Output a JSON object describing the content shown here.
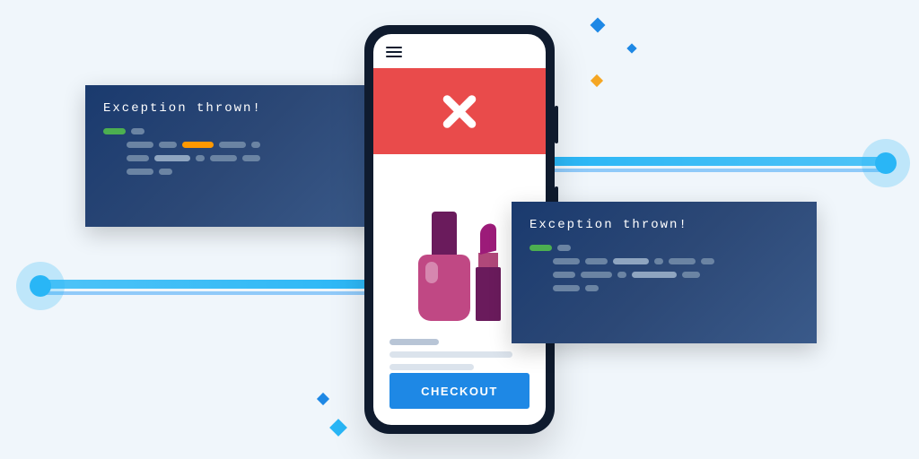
{
  "colors": {
    "background": "#f0f6fb",
    "panel_gradient_from": "#1a3a6e",
    "panel_gradient_to": "#3a5a8a",
    "error_red": "#e94b4b",
    "accent_blue": "#1e88e5",
    "accent_orange": "#f5a623",
    "signal_cyan": "#29b6f6"
  },
  "code_panels": {
    "left": {
      "title": "Exception thrown!"
    },
    "right": {
      "title": "Exception thrown!"
    }
  },
  "phone": {
    "error_banner": {
      "icon": "close-x"
    },
    "product": {
      "items": [
        "nail-polish",
        "lipstick"
      ]
    },
    "checkout_label": "CHECKOUT"
  }
}
